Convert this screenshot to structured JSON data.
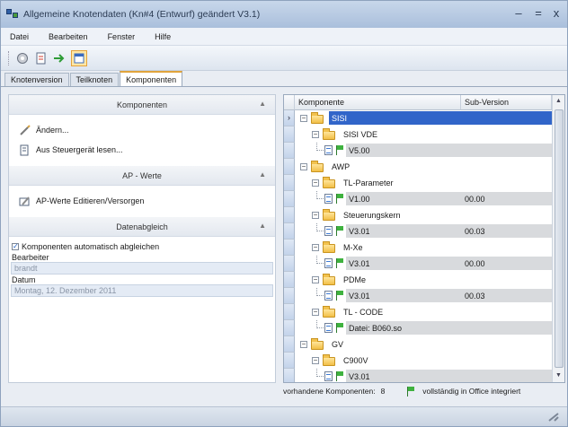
{
  "window": {
    "title": "Allgemeine Knotendaten (Kn#4 (Entwurf) geändert V3.1)",
    "minimize": "–",
    "maximize": "=",
    "close": "x"
  },
  "menu": [
    "Datei",
    "Bearbeiten",
    "Fenster",
    "Hilfe"
  ],
  "toolbar": {
    "icons": [
      "open-icon",
      "document-icon",
      "arrows-icon",
      "window-icon"
    ]
  },
  "tabs": [
    "Knotenversion",
    "Teilknoten",
    "Komponenten"
  ],
  "active_tab": "Komponenten",
  "left": {
    "komponenten": {
      "header": "Komponenten",
      "actions": [
        "Ändern...",
        "Aus Steuergerät lesen..."
      ]
    },
    "ap_werte": {
      "header": "AP - Werte",
      "actions": [
        "AP-Werte Editieren/Versorgen"
      ]
    },
    "datenabgleich": {
      "header": "Datenabgleich",
      "checkbox_label": "Komponenten automatisch abgleichen",
      "checkbox_checked": true,
      "bearbeiter_label": "Bearbeiter",
      "bearbeiter_value": "brandt",
      "datum_label": "Datum",
      "datum_value": "Montag, 12. Dezember 2011"
    }
  },
  "grid": {
    "columns": [
      "Komponente",
      "Sub-Version"
    ],
    "rows": [
      {
        "level": 0,
        "type": "folder",
        "name": "SISI",
        "sub": "",
        "selected": true
      },
      {
        "level": 1,
        "type": "folder",
        "name": "SISI VDE",
        "sub": ""
      },
      {
        "level": 2,
        "type": "leaf",
        "name": "V5.00",
        "sub": ""
      },
      {
        "level": 0,
        "type": "folder",
        "name": "AWP",
        "sub": ""
      },
      {
        "level": 1,
        "type": "folder",
        "name": "TL-Parameter",
        "sub": ""
      },
      {
        "level": 2,
        "type": "leaf",
        "name": "V1.00",
        "sub": "00.00"
      },
      {
        "level": 1,
        "type": "folder",
        "name": "Steuerungskern",
        "sub": ""
      },
      {
        "level": 2,
        "type": "leaf",
        "name": "V3.01",
        "sub": "00.03"
      },
      {
        "level": 1,
        "type": "folder",
        "name": "M-Xe",
        "sub": ""
      },
      {
        "level": 2,
        "type": "leaf",
        "name": "V3.01",
        "sub": "00.00"
      },
      {
        "level": 1,
        "type": "folder",
        "name": "PDMe",
        "sub": ""
      },
      {
        "level": 2,
        "type": "leaf",
        "name": "V3.01",
        "sub": "00.03"
      },
      {
        "level": 1,
        "type": "folder",
        "name": "TL - CODE",
        "sub": ""
      },
      {
        "level": 2,
        "type": "leaf",
        "name": "Datei: B060.so",
        "sub": ""
      },
      {
        "level": 0,
        "type": "folder",
        "name": "GV",
        "sub": ""
      },
      {
        "level": 1,
        "type": "folder",
        "name": "C900V",
        "sub": ""
      },
      {
        "level": 2,
        "type": "leaf",
        "name": "V3.01",
        "sub": ""
      }
    ]
  },
  "status": {
    "count_label": "vorhandene Komponenten:",
    "count": "8",
    "integrated_label": "vollständig in Office integriert"
  },
  "colors": {
    "selection": "#3165c9",
    "accent": "#e0a43c",
    "shaded": "#d8dadd"
  }
}
